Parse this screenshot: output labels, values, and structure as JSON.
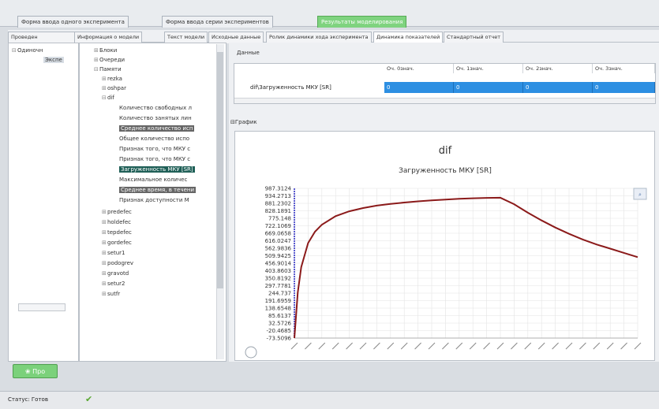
{
  "top_tabs": [
    {
      "label": "Форма ввода одного эксперимента"
    },
    {
      "label": "Форма ввода серии экспериментов"
    },
    {
      "label": "Результаты моделирования"
    }
  ],
  "sub_tabs": [
    {
      "label": "Проведен"
    },
    {
      "label": "Информация о модели"
    },
    {
      "label": "Текст модели"
    },
    {
      "label": "Исходные данные"
    },
    {
      "label": "Ролик динамики хода эксперимента"
    },
    {
      "label": "Динамика показателей"
    },
    {
      "label": "Стандартный отчет"
    }
  ],
  "left_tree": [
    {
      "label": "Одиночн"
    },
    {
      "label": "Экспе"
    }
  ],
  "tree": [
    {
      "label": "Блоки"
    },
    {
      "label": "Очереди"
    },
    {
      "label": "Памяти"
    },
    {
      "label": "rezka"
    },
    {
      "label": "oshpar"
    },
    {
      "label": "dif"
    },
    {
      "label": "Количество свободных л"
    },
    {
      "label": "Количество занятых лин"
    },
    {
      "label": "Среднее количество исп"
    },
    {
      "label": "Общее количество испо"
    },
    {
      "label": "Признак того, что МКУ с"
    },
    {
      "label": "Признак того, что МКУ с"
    },
    {
      "label": "Загруженность МКУ [SR]"
    },
    {
      "label": "Максимальное количес"
    },
    {
      "label": "Среднее время, в течени"
    },
    {
      "label": "Признак доступности М"
    },
    {
      "label": "predefec"
    },
    {
      "label": "holdefec"
    },
    {
      "label": "tepdefec"
    },
    {
      "label": "gordefec"
    },
    {
      "label": "setur1"
    },
    {
      "label": "podogrev"
    },
    {
      "label": "gravotd"
    },
    {
      "label": "setur2"
    },
    {
      "label": "sutfr"
    }
  ],
  "data_panel": {
    "title": "Данные",
    "columns": [
      "Оч. 0знач.",
      "Оч. 1знач.",
      "Оч. 2знач.",
      "Оч. 3знач."
    ],
    "row_label": "dif\\Загруженность МКУ [SR]",
    "row_values": [
      "0",
      "0",
      "0",
      "0"
    ]
  },
  "chart_panel": {
    "title": "График"
  },
  "chart_data": {
    "type": "line",
    "title": "dif",
    "subtitle": "Загруженность МКУ [SR]",
    "y_ticks": [
      "987.3124",
      "934.2713",
      "881.2302",
      "828.1891",
      "775.148",
      "722.1069",
      "669.0658",
      "616.0247",
      "562.9836",
      "509.9425",
      "456.9014",
      "403.8603",
      "350.8192",
      "297.7781",
      "244.737",
      "191.6959",
      "138.6548",
      "85.6137",
      "32.5726",
      "-20.4685",
      "-73.5096"
    ],
    "ylim": [
      -73.5096,
      987.3124
    ],
    "xlim": [
      0,
      25
    ],
    "x_tick_count": 26,
    "series": [
      {
        "color": "#8b1a1a",
        "x": [
          0,
          0.25,
          0.5,
          1,
          1.5,
          2,
          3,
          4,
          5,
          6,
          7,
          8,
          9,
          10,
          11,
          12,
          13,
          14,
          15,
          16,
          17,
          18,
          19,
          20,
          21,
          22,
          23,
          24,
          25
        ],
        "y": [
          -73.5,
          250,
          430,
          600,
          680,
          730,
          790,
          825,
          848,
          865,
          877,
          887,
          895,
          902,
          908,
          913,
          917,
          920,
          921,
          875,
          815,
          760,
          710,
          665,
          625,
          590,
          560,
          530,
          500
        ]
      }
    ]
  },
  "bottom": {
    "button_label": "Про"
  },
  "status": {
    "label": "Статус: Готов"
  }
}
